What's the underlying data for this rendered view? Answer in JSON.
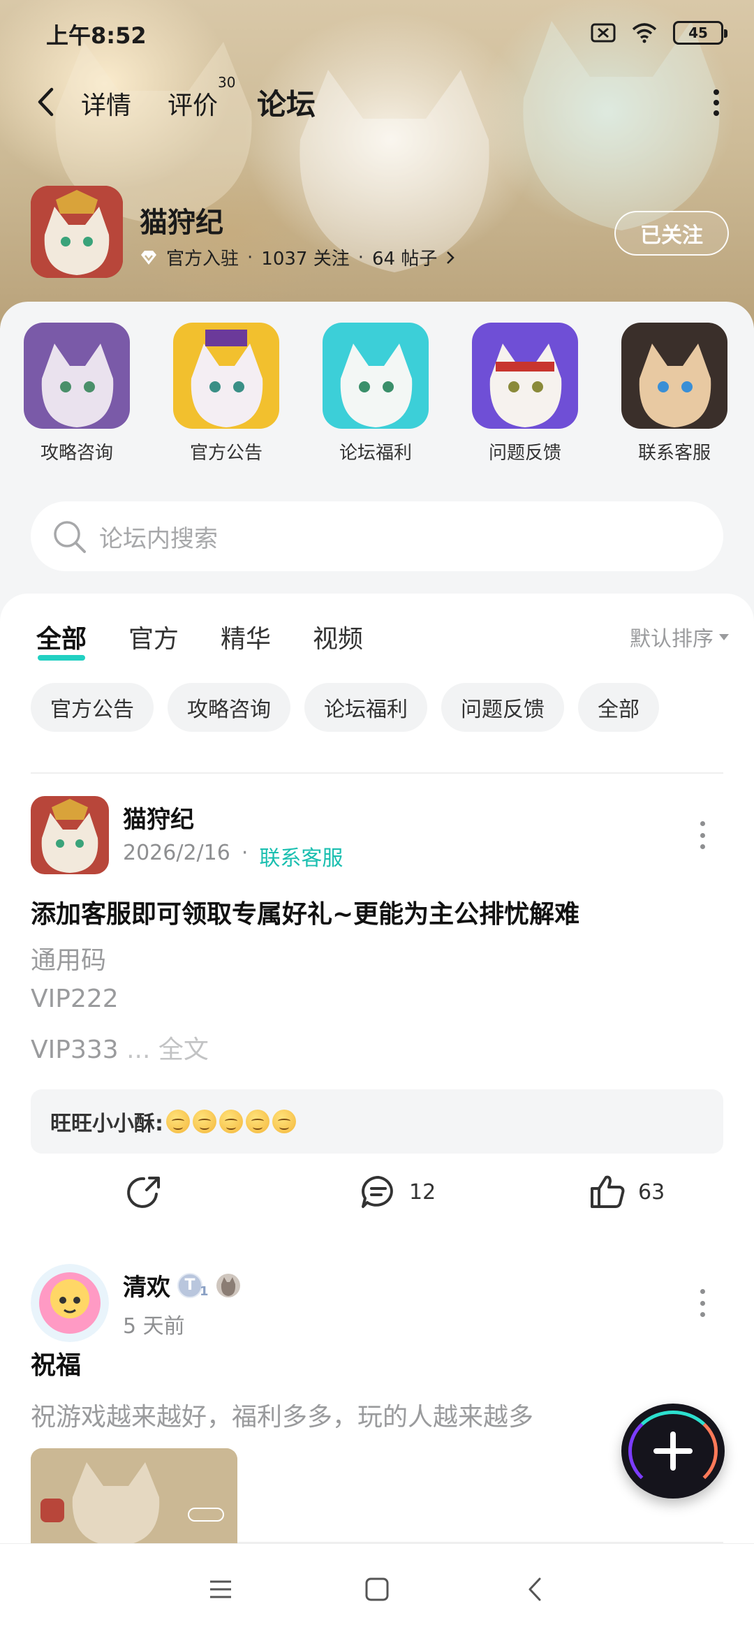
{
  "status_bar": {
    "time": "上午8:52",
    "battery": "45"
  },
  "nav": {
    "tabs": [
      {
        "label": "详情"
      },
      {
        "label": "评价"
      },
      {
        "label": "论坛"
      }
    ],
    "review_count": "30",
    "active_tab": "论坛"
  },
  "game": {
    "name": "猫狩纪",
    "official": "官方入驻",
    "followers": "1037 关注",
    "posts": "64 帖子",
    "follow_label": "已关注"
  },
  "quick_links": [
    {
      "label": "攻略咨询"
    },
    {
      "label": "官方公告"
    },
    {
      "label": "论坛福利"
    },
    {
      "label": "问题反馈"
    },
    {
      "label": "联系客服"
    }
  ],
  "search": {
    "placeholder": "论坛内搜索"
  },
  "feed": {
    "tabs": [
      {
        "label": "全部"
      },
      {
        "label": "官方"
      },
      {
        "label": "精华"
      },
      {
        "label": "视频"
      }
    ],
    "sort_label": "默认排序",
    "chips": [
      {
        "label": "官方公告"
      },
      {
        "label": "攻略咨询"
      },
      {
        "label": "论坛福利"
      },
      {
        "label": "问题反馈"
      },
      {
        "label": "全部"
      }
    ]
  },
  "posts": [
    {
      "author": "猫狩纪",
      "date": "2026/2/16",
      "category": "联系客服",
      "title": "添加客服即可领取专属好礼~更能为主公排忧解难",
      "lines": [
        "通用码",
        "VIP222",
        "VIP333"
      ],
      "ellipsis": " ... ",
      "more_label": "全文",
      "comment_user": "旺旺小小酥:",
      "comment_count": "12",
      "like_count": "63"
    },
    {
      "author": "清欢",
      "level_badge": "T",
      "level_num": "1",
      "time": "5 天前",
      "title": "祝福",
      "body": "祝游戏越来越好，福利多多，玩的人越来越多"
    }
  ],
  "colors": {
    "accent": "#21d0c2",
    "link": "#1bbfb0"
  }
}
